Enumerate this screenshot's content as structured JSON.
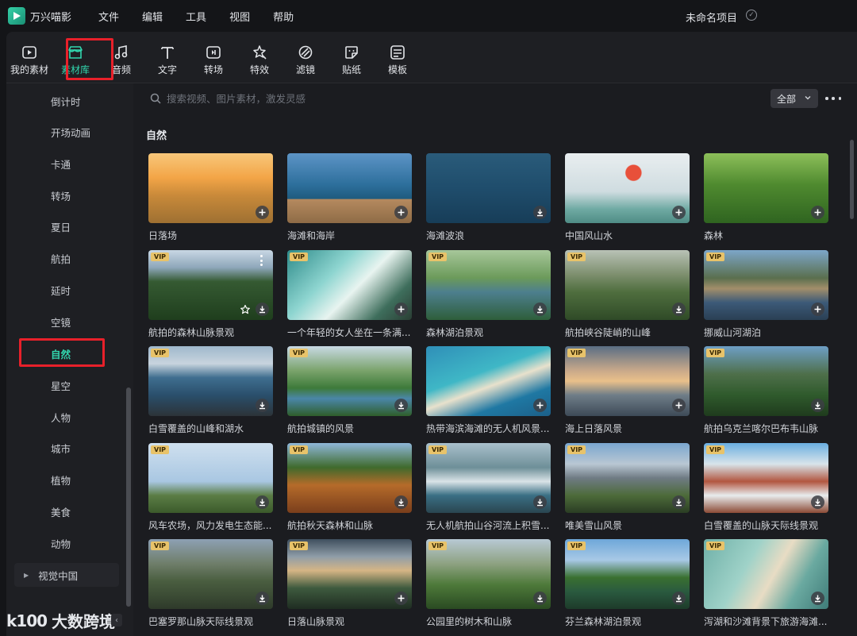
{
  "app": {
    "name": "万兴喵影",
    "project_name": "未命名项目"
  },
  "menu": [
    "文件",
    "编辑",
    "工具",
    "视图",
    "帮助"
  ],
  "toolbar": [
    {
      "label": "我的素材",
      "icon": "media-icon"
    },
    {
      "label": "素材库",
      "icon": "store-icon",
      "active": true
    },
    {
      "label": "音频",
      "icon": "music-icon"
    },
    {
      "label": "文字",
      "icon": "text-icon"
    },
    {
      "label": "转场",
      "icon": "transition-icon"
    },
    {
      "label": "特效",
      "icon": "effects-icon"
    },
    {
      "label": "滤镜",
      "icon": "filter-icon"
    },
    {
      "label": "贴纸",
      "icon": "sticker-icon"
    },
    {
      "label": "模板",
      "icon": "template-icon"
    }
  ],
  "sidebar": {
    "items": [
      "倒计时",
      "开场动画",
      "卡通",
      "转场",
      "夏日",
      "航拍",
      "延时",
      "空镜",
      "自然",
      "星空",
      "人物",
      "城市",
      "植物",
      "美食",
      "动物"
    ],
    "active": "自然",
    "group": "视觉中国"
  },
  "search": {
    "placeholder": "搜索视频、图片素材，激发灵感"
  },
  "filter": {
    "selected": "全部"
  },
  "section": {
    "title": "自然"
  },
  "cards": [
    {
      "title": "日落场",
      "vip": false,
      "action": "add"
    },
    {
      "title": "海滩和海岸",
      "vip": false,
      "action": "add"
    },
    {
      "title": "海滩波浪",
      "vip": false,
      "action": "download"
    },
    {
      "title": "中国风山水",
      "vip": false,
      "action": "add"
    },
    {
      "title": "森林",
      "vip": false,
      "action": "add"
    },
    {
      "title": "航拍的森林山脉景观",
      "vip": true,
      "action": "download",
      "hover": true
    },
    {
      "title": "一个年轻的女人坐在一条满...",
      "vip": true,
      "action": "add"
    },
    {
      "title": "森林湖泊景观",
      "vip": true,
      "action": "download"
    },
    {
      "title": "航拍峡谷陡峭的山峰",
      "vip": true,
      "action": "download"
    },
    {
      "title": "挪威山河湖泊",
      "vip": true,
      "action": "add"
    },
    {
      "title": "白雪覆盖的山峰和湖水",
      "vip": true,
      "action": "download"
    },
    {
      "title": "航拍城镇的风景",
      "vip": true,
      "action": "download"
    },
    {
      "title": "热带海滨海滩的无人机风景...",
      "vip": false,
      "action": "add"
    },
    {
      "title": "海上日落风景",
      "vip": true,
      "action": "add"
    },
    {
      "title": "航拍乌克兰喀尔巴布韦山脉",
      "vip": true,
      "action": "download"
    },
    {
      "title": "风车农场，风力发电生态能...",
      "vip": true,
      "action": "download"
    },
    {
      "title": "航拍秋天森林和山脉",
      "vip": true,
      "action": "download"
    },
    {
      "title": "无人机航拍山谷河流上积雪...",
      "vip": true,
      "action": "download"
    },
    {
      "title": "唯美雪山风景",
      "vip": true,
      "action": "download"
    },
    {
      "title": "白雪覆盖的山脉天际线景观",
      "vip": true,
      "action": "download"
    },
    {
      "title": "巴塞罗那山脉天际线景观",
      "vip": true,
      "action": "download"
    },
    {
      "title": "日落山脉景观",
      "vip": true,
      "action": "add"
    },
    {
      "title": "公园里的树木和山脉",
      "vip": true,
      "action": "download"
    },
    {
      "title": "芬兰森林湖泊景观",
      "vip": true,
      "action": "download"
    },
    {
      "title": "泻湖和沙滩背景下旅游海滩...",
      "vip": true,
      "action": "download"
    }
  ],
  "vip_label": "VIP",
  "watermark": {
    "logo": "k100",
    "text": "大数跨境"
  },
  "colors": {
    "accent": "#32d6ae",
    "highlight": "#e8202a",
    "vip": "#e8c36a"
  }
}
